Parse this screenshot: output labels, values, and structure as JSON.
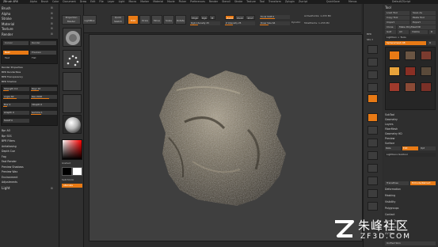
{
  "menubar": {
    "title": "ZBrush 4R6",
    "items": [
      "Alpha",
      "Brush",
      "Color",
      "Document",
      "Draw",
      "Edit",
      "File",
      "Layer",
      "Light",
      "Macro",
      "Marker",
      "Material",
      "Movie",
      "Picker",
      "Preferences",
      "Render",
      "Stencil",
      "Stroke",
      "Texture",
      "Tool",
      "Transform",
      "Zplugin",
      "Zscript"
    ],
    "right_left": "QuickSave",
    "right_mid": "Menus",
    "right_right": "DefaultZScript"
  },
  "left_panel": {
    "sections": [
      "Brush",
      "Alpha",
      "Stroke",
      "Material",
      "Texture",
      "Render"
    ],
    "render_tabs": [
      "Cursor",
      "Render"
    ],
    "modes": {
      "best": "Best",
      "preview": "Preview",
      "fast": "Fast",
      "flat": "Flat"
    },
    "properties": [
      "Render Properties",
      "BPR RenderPass",
      "BPR Transparency",
      "BPR Shadow"
    ],
    "sliders": [
      {
        "label": "Strength 0.2",
        "fill": 0.2
      },
      {
        "label": "Rays 16",
        "fill": 0.3
      },
      {
        "label": "Angle 60",
        "fill": 0.5
      },
      {
        "label": "Res 2048",
        "fill": 0.7
      },
      {
        "label": "Blur 4",
        "fill": 0.15
      },
      {
        "label": "VDepth 0",
        "fill": 0.0
      },
      {
        "label": "LDepth 0",
        "fill": 0.0
      },
      {
        "label": "Gamma 1",
        "fill": 0.4
      },
      {
        "label": "Falloff 0",
        "fill": 0.0
      }
    ],
    "lower": [
      "Bpr AO",
      "Bpr SSS",
      "BPR Filters",
      "Antialiasing",
      "Depth Cue",
      "Fog",
      "Fast Render",
      "Preview Shadows",
      "Preview Wax",
      "Environment",
      "Adjustments"
    ],
    "light": "Light"
  },
  "shelf": {
    "gradient": "Gradient",
    "switch": "SwitchColor",
    "alternate": "Alternate"
  },
  "toolbar": {
    "projection_master": "Projection Master",
    "lightbox": "LightBox",
    "quick_sketch": "Quick Sketch",
    "edit": "Edit",
    "draw": "Draw",
    "move": "Move",
    "scale": "Scale",
    "rotate": "Rotate",
    "mrgb": "Mrgb",
    "rgb": "Rgb",
    "m": "M",
    "zadd": "Zadd",
    "zsub": "Zsub",
    "zcut": "Zcut",
    "focal_shift": "Focal Shift 0",
    "draw_size": "Draw Size 64",
    "rgb_intensity": "Rgb Intensity 25",
    "z_intensity": "Z Intensity 25",
    "dynamic": "Dynamic",
    "active_points": "ActivePoints: 1.233 Mil",
    "total_points": "TotalPoints: 1.233 Mil"
  },
  "right_shelf": {
    "bpr": "BPR",
    "spix": "SPix 3",
    "scroll": "Scroll",
    "zoom": "Zoom",
    "actual": "Actual",
    "aahalf": "AAHalf",
    "persp": "Persp",
    "floor": "Floor",
    "local": "Local",
    "frame": "Frame",
    "move": "Move",
    "scale": "Scale",
    "rotate": "Rotate",
    "transp": "Transp",
    "solo": "Solo"
  },
  "right_panel": {
    "tool": "Tool",
    "load_tool": "Load Tool",
    "save_as": "Save As",
    "copy_tool": "Copy Tool",
    "paste_tool": "Paste Tool",
    "import": "Import",
    "export": "Export",
    "clone": "Clone",
    "make_polymesh": "Make PolyMesh3D",
    "goz": "GoZ",
    "all": "All",
    "visible": "Visible",
    "r": "R",
    "lightbox_tools": "Lightbox > Tools",
    "current_tool": "Spheremesh 48",
    "r_label": "R",
    "subtools": [
      "SubTool",
      "Geometry",
      "Layers",
      "FiberMesh",
      "Geometry HD",
      "Preview",
      "Surface",
      "Deformation",
      "Masking",
      "Visibility",
      "Polygroups",
      "Contact",
      "Morph Target",
      "Polypaint",
      "UV Map"
    ],
    "slider_a": "Rate",
    "slider_b": "Edit",
    "slider_c": "Opt",
    "edit_btn": "Lightbox>Subtool",
    "buttons": [
      "TransPose",
      "Extrude/Retract"
    ],
    "unify": "Unified Skin"
  },
  "watermark": {
    "cn": "朱峰社区",
    "url": "ZF3D.COM"
  },
  "colors": {
    "accent": "#e87a15",
    "canvas": "#3f3f3f",
    "panel": "#2f2f2f"
  }
}
